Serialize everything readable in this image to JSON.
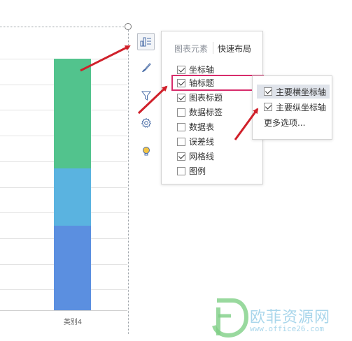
{
  "chart_data": {
    "type": "bar",
    "stacked": true,
    "categories": [
      "类别4"
    ],
    "series_colors": [
      "#5b8fe0",
      "#5ab3e0",
      "#52c38d"
    ],
    "segment_values_fraction": [
      0.336,
      0.228,
      0.436
    ],
    "grid": true
  },
  "toolbar": {
    "icons": [
      "chart-elements-icon",
      "brush-icon",
      "filter-icon",
      "gear-icon",
      "bulb-icon"
    ]
  },
  "panel": {
    "tab_active": "图表元素",
    "tab_other": "快速布局",
    "items": [
      {
        "label": "坐标轴",
        "checked": true
      },
      {
        "label": "轴标题",
        "checked": true
      },
      {
        "label": "图表标题",
        "checked": true
      },
      {
        "label": "数据标签",
        "checked": false
      },
      {
        "label": "数据表",
        "checked": false
      },
      {
        "label": "误差线",
        "checked": false
      },
      {
        "label": "网格线",
        "checked": true
      },
      {
        "label": "图例",
        "checked": false
      }
    ]
  },
  "submenu": {
    "items": [
      {
        "label": "主要横坐标轴",
        "checked": true
      },
      {
        "label": "主要纵坐标轴",
        "checked": true
      }
    ],
    "more": "更多选项..."
  },
  "watermark": {
    "name": "欧菲资源网",
    "url": "www.office26.com"
  },
  "colors": {
    "highlight_border": "#d72c6b",
    "arrow": "#d0202a"
  }
}
